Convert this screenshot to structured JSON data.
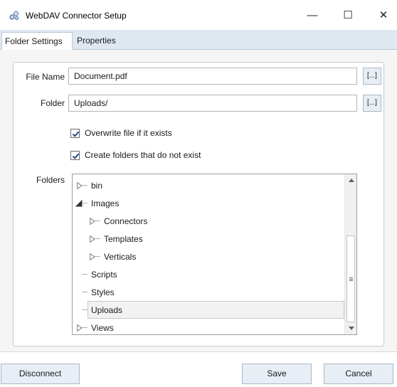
{
  "window": {
    "title": "WebDAV Connector Setup",
    "minimize_glyph": "—",
    "maximize_glyph": "☐",
    "close_glyph": "✕"
  },
  "tabs": [
    {
      "label": "Folder Settings",
      "active": true
    },
    {
      "label": "Properties",
      "active": false
    }
  ],
  "form": {
    "file_name_label": "File Name",
    "file_name_value": "Document.pdf",
    "folder_label": "Folder",
    "folder_value": "Uploads/",
    "browse_label": "[...]",
    "overwrite_label": "Overwrite file if it exists",
    "overwrite_checked": true,
    "create_folders_label": "Create folders that do not exist",
    "create_folders_checked": true,
    "folders_label": "Folders"
  },
  "tree": {
    "items": [
      {
        "label": "bin",
        "level": 0,
        "expander": "collapsed"
      },
      {
        "label": "Images",
        "level": 0,
        "expander": "expanded"
      },
      {
        "label": "Connectors",
        "level": 1,
        "expander": "collapsed"
      },
      {
        "label": "Templates",
        "level": 1,
        "expander": "collapsed"
      },
      {
        "label": "Verticals",
        "level": 1,
        "expander": "collapsed"
      },
      {
        "label": "Scripts",
        "level": 0,
        "expander": "none"
      },
      {
        "label": "Styles",
        "level": 0,
        "expander": "none"
      },
      {
        "label": "Uploads",
        "level": 0,
        "expander": "none",
        "selected": true
      },
      {
        "label": "Views",
        "level": 0,
        "expander": "collapsed"
      }
    ]
  },
  "footer": {
    "disconnect_label": "Disconnect",
    "save_label": "Save",
    "cancel_label": "Cancel"
  },
  "colors": {
    "tab_strip": "#dfe8f1",
    "button_face": "#e8eef5",
    "button_border": "#a9b8c8",
    "checkbox_check": "#1f4e8c"
  }
}
